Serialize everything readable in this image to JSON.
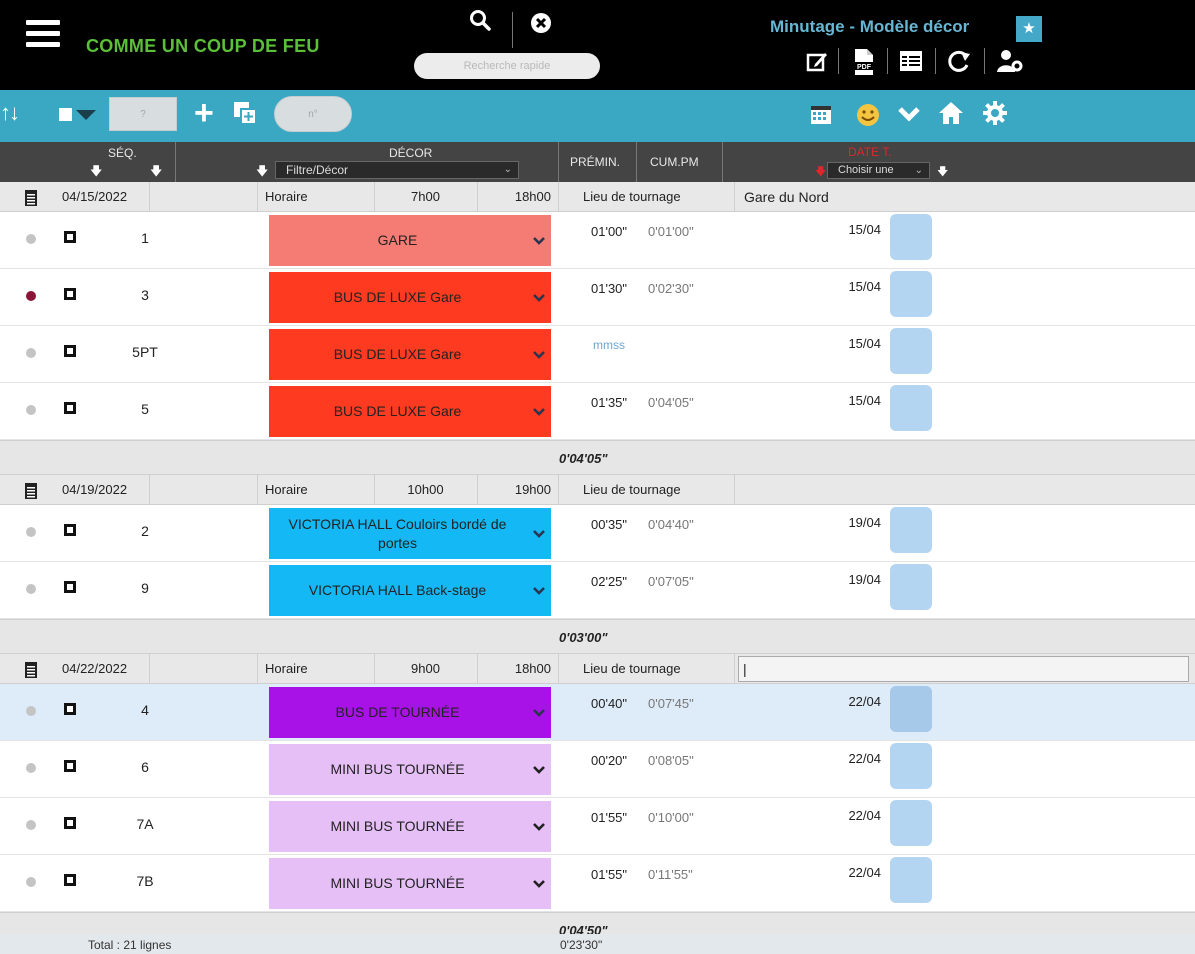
{
  "app": {
    "title": "COMME UN COUP DE FEU",
    "view_title": "Minutage - Modèle décor",
    "search_placeholder": "Recherche rapide"
  },
  "toolbar": {
    "input1": "?",
    "input2": "n°"
  },
  "columns": {
    "seq": "SÉQ.",
    "decor": "DÉCOR",
    "decor_filter": "Filtre/Décor",
    "premin": "PRÉMIN.",
    "cumpm": "CUM.PM",
    "date": "DATE T.",
    "date_choice": "Choisir une"
  },
  "days": [
    {
      "date": "04/15/2022",
      "horaire_label": "Horaire",
      "start": "7h00",
      "end": "18h00",
      "lieu_label": "Lieu de tournage",
      "lieu": "Gare du Nord",
      "subtotal": "0'04'05\"",
      "rows": [
        {
          "seq": "1",
          "decor": "GARE",
          "color": "#f47c74",
          "premin": "01'00\"",
          "cum": "0'01'00\"",
          "date": "15/04",
          "dot": "#c4c4c4"
        },
        {
          "seq": "3",
          "decor": "BUS DE LUXE Gare",
          "color": "#fe3a20",
          "premin": "01'30\"",
          "cum": "0'02'30\"",
          "date": "15/04",
          "dot": "#8b1538"
        },
        {
          "seq": "5PT",
          "decor": "BUS DE LUXE Gare",
          "color": "#fe3a20",
          "premin": "mmss",
          "cum": "",
          "date": "15/04",
          "dot": "#c4c4c4"
        },
        {
          "seq": "5",
          "decor": "BUS DE LUXE Gare",
          "color": "#fe3a20",
          "premin": "01'35\"",
          "cum": "0'04'05\"",
          "date": "15/04",
          "dot": "#c4c4c4"
        }
      ]
    },
    {
      "date": "04/19/2022",
      "horaire_label": "Horaire",
      "start": "10h00",
      "end": "19h00",
      "lieu_label": "Lieu de tournage",
      "lieu": "",
      "subtotal": "0'03'00\"",
      "rows": [
        {
          "seq": "2",
          "decor": "VICTORIA HALL Couloirs bordé de portes",
          "color": "#13b8f4",
          "premin": "00'35\"",
          "cum": "0'04'40\"",
          "date": "19/04",
          "dot": "#c4c4c4"
        },
        {
          "seq": "9",
          "decor": "VICTORIA HALL Back-stage",
          "color": "#13b8f4",
          "premin": "02'25\"",
          "cum": "0'07'05\"",
          "date": "19/04",
          "dot": "#c4c4c4"
        }
      ]
    },
    {
      "date": "04/22/2022",
      "horaire_label": "Horaire",
      "start": "9h00",
      "end": "18h00",
      "lieu_label": "Lieu de tournage",
      "lieu": "|",
      "subtotal": "0'04'50\"",
      "rows": [
        {
          "seq": "4",
          "decor": "BUS DE TOURNÉE",
          "color": "#a812e6",
          "premin": "00'40\"",
          "cum": "0'07'45\"",
          "date": "22/04",
          "dot": "#c4c4c4",
          "selected": true
        },
        {
          "seq": "6",
          "decor": "MINI BUS TOURNÉE",
          "color": "#e6bff6",
          "premin": "00'20\"",
          "cum": "0'08'05\"",
          "date": "22/04",
          "dot": "#c4c4c4"
        },
        {
          "seq": "7A",
          "decor": "MINI BUS TOURNÉE",
          "color": "#e6bff6",
          "premin": "01'55\"",
          "cum": "0'10'00\"",
          "date": "22/04",
          "dot": "#c4c4c4"
        },
        {
          "seq": "7B",
          "decor": "MINI BUS TOURNÉE",
          "color": "#e6bff6",
          "premin": "01'55\"",
          "cum": "0'11'55\"",
          "date": "22/04",
          "dot": "#c4c4c4"
        }
      ]
    }
  ],
  "footer": {
    "total_lines": "Total : 21 lignes",
    "total_time": "0'23'30\""
  },
  "colors": {
    "topbar": "#000000",
    "toolbar": "#3aa8c3",
    "title_green": "#5bbf3a",
    "title_blue": "#67b6d4",
    "date_red": "#e0262b",
    "slot_blue": "#b3d5f2"
  }
}
